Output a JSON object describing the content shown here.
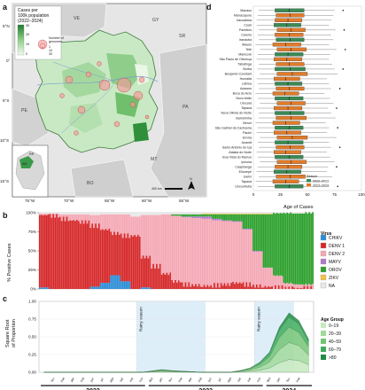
{
  "panel_labels": {
    "a": "a",
    "b": "b",
    "c": "c",
    "d": "d"
  },
  "map": {
    "legend_title": "Cases per\n100k population\n(2022–2024)",
    "legend_ticks": [
      "0",
      "1K",
      "2K",
      "3K"
    ],
    "bubble_title": "Number of\ngenomes",
    "bubble_values": [
      "1",
      "10",
      "30"
    ],
    "country_labels": [
      "VE",
      "CO",
      "GY",
      "SR",
      "PE",
      "BO",
      "PA",
      "MT",
      "AM",
      "RR"
    ],
    "lat_labels": [
      "5°N",
      "0°",
      "5°S",
      "10°S",
      "15°S"
    ],
    "lon_labels": [
      "75°W",
      "70°W",
      "65°W",
      "60°W",
      "55°W"
    ],
    "scale_label": "400 km",
    "north": "N",
    "inset_label": "AM"
  },
  "colors": {
    "CHIKV": "#2b8cd6",
    "DENV1": "#d62728",
    "DENV2": "#f4a7b4",
    "MAYV": "#b07ac8",
    "OROV": "#2ca02c",
    "ZIKV": "#f3c244",
    "NA": "#e8e8e8",
    "age": [
      "#c7e9c0",
      "#a1d99b",
      "#74c476",
      "#41ab5d",
      "#238b45",
      "#005a32"
    ],
    "box2022": "#3a8a54",
    "box2023": "#e07b2a"
  },
  "chart_data": [
    {
      "panel": "b",
      "type": "bar",
      "ylabel": "% Positive Cases",
      "yticks": [
        "0%",
        "25%",
        "50%",
        "75%",
        "100%"
      ],
      "ylim": [
        0,
        100
      ],
      "legend_title": "Virus",
      "legend": [
        "CHIKV",
        "DENV 1",
        "DENV 2",
        "MAYV",
        "OROV",
        "ZIKV",
        "NA"
      ],
      "categories": [
        "Jan 2022",
        "Feb 2022",
        "Mar 2022",
        "Apr 2022",
        "May 2022",
        "Jun 2022",
        "Jul 2022",
        "Aug 2022",
        "Sep 2022",
        "Oct 2022",
        "Nov 2022",
        "Dec 2022",
        "Jan 2023",
        "Feb 2023",
        "Mar 2023",
        "Apr 2023",
        "May 2023",
        "Jun 2023",
        "Jul 2023",
        "Aug 2023",
        "Sep 2023",
        "Oct 2023",
        "Nov 2023",
        "Dec 2023",
        "Jan 2024",
        "Feb 2024",
        "Mar 2024"
      ],
      "series": [
        {
          "name": "CHIKV",
          "values": [
            2,
            0,
            0,
            0,
            0,
            3,
            8,
            18,
            10,
            0,
            2,
            0,
            0,
            0,
            0,
            0,
            0,
            0,
            0,
            0,
            0,
            0,
            0,
            0,
            0,
            0,
            0
          ]
        },
        {
          "name": "DENV 1",
          "values": [
            95,
            96,
            92,
            90,
            88,
            80,
            70,
            55,
            60,
            70,
            40,
            30,
            20,
            10,
            6,
            5,
            4,
            5,
            6,
            8,
            6,
            4,
            3,
            2,
            1,
            1,
            1
          ]
        },
        {
          "name": "DENV 2",
          "values": [
            2,
            3,
            6,
            8,
            10,
            14,
            20,
            25,
            28,
            25,
            55,
            67,
            78,
            86,
            88,
            88,
            88,
            85,
            83,
            80,
            72,
            45,
            25,
            15,
            6,
            5,
            4
          ]
        },
        {
          "name": "MAYV",
          "values": [
            0,
            0,
            0,
            0,
            0,
            0,
            0,
            0,
            0,
            0,
            0,
            0,
            0,
            0,
            1,
            2,
            3,
            2,
            1,
            1,
            1,
            1,
            0,
            0,
            0,
            0,
            0
          ]
        },
        {
          "name": "OROV",
          "values": [
            0,
            0,
            0,
            0,
            0,
            0,
            0,
            0,
            0,
            0,
            0,
            0,
            0,
            2,
            3,
            3,
            3,
            6,
            8,
            9,
            19,
            48,
            70,
            82,
            92,
            93,
            94
          ]
        },
        {
          "name": "ZIKV",
          "values": [
            0,
            0,
            0,
            0,
            0,
            0,
            0,
            0,
            0,
            0,
            0,
            0,
            0,
            0,
            0,
            0,
            1,
            1,
            1,
            1,
            1,
            1,
            1,
            0,
            0,
            0,
            0
          ]
        },
        {
          "name": "NA",
          "values": [
            1,
            1,
            2,
            2,
            2,
            3,
            2,
            2,
            2,
            5,
            3,
            3,
            2,
            2,
            2,
            2,
            1,
            1,
            1,
            1,
            1,
            1,
            1,
            1,
            1,
            1,
            1
          ]
        }
      ]
    },
    {
      "panel": "c",
      "type": "area",
      "ylabel": "Square Root\nof Proportion",
      "yticks": [
        "0.00",
        "0.25",
        "0.50",
        "0.75",
        "1.00"
      ],
      "ylim": [
        0,
        1
      ],
      "annotations": [
        "Rainy season",
        "Rainy season"
      ],
      "rainy_seasons": [
        [
          10,
          17
        ],
        [
          22,
          26
        ]
      ],
      "x_month_labels": [
        "fev",
        "mar",
        "abr",
        "mai",
        "jun",
        "jul",
        "ago",
        "set",
        "out",
        "nov",
        "dez",
        "jan",
        "fev",
        "mar",
        "abr",
        "mai",
        "jun",
        "jul",
        "ago",
        "set",
        "out",
        "nov",
        "dez",
        "jan",
        "fev",
        "mar"
      ],
      "years": [
        "2022",
        "2023",
        "2024"
      ],
      "legend_title": "Age Group",
      "legend": [
        "0–19",
        "20–39",
        "40–59",
        "60–79",
        ">80"
      ],
      "series": [
        {
          "name": "0–19",
          "values": [
            0,
            0,
            0,
            0,
            0,
            0,
            0,
            0,
            0,
            0,
            0,
            0.02,
            0.03,
            0.02,
            0.01,
            0.01,
            0,
            0,
            0,
            0,
            0.02,
            0.05,
            0.1,
            0.2,
            0.45,
            0.6,
            0.55,
            0.35
          ]
        },
        {
          "name": "20–39",
          "values": [
            0,
            0,
            0,
            0,
            0,
            0,
            0,
            0,
            0,
            0,
            0,
            0.02,
            0.04,
            0.03,
            0.02,
            0.01,
            0,
            0,
            0,
            0,
            0.03,
            0.06,
            0.14,
            0.28,
            0.62,
            0.8,
            0.7,
            0.45
          ]
        },
        {
          "name": "40–59",
          "values": [
            0,
            0,
            0,
            0,
            0,
            0,
            0,
            0,
            0,
            0,
            0,
            0.01,
            0.03,
            0.02,
            0.01,
            0.01,
            0,
            0,
            0,
            0,
            0.02,
            0.05,
            0.12,
            0.25,
            0.55,
            0.72,
            0.62,
            0.4
          ]
        },
        {
          "name": "60–79",
          "values": [
            0,
            0,
            0,
            0,
            0,
            0,
            0,
            0,
            0,
            0,
            0,
            0.01,
            0.02,
            0.01,
            0.01,
            0,
            0,
            0,
            0,
            0,
            0.01,
            0.03,
            0.08,
            0.16,
            0.36,
            0.48,
            0.4,
            0.25
          ]
        },
        {
          "name": ">80",
          "values": [
            0,
            0,
            0,
            0,
            0,
            0,
            0,
            0,
            0,
            0,
            0,
            0,
            0.01,
            0,
            0,
            0,
            0,
            0,
            0,
            0,
            0,
            0.01,
            0.03,
            0.06,
            0.14,
            0.2,
            0.16,
            0.1
          ]
        }
      ]
    },
    {
      "panel": "d",
      "type": "boxplot",
      "xlabel": "Age of Cases",
      "xlim": [
        0,
        100
      ],
      "xticks": [
        "0",
        "25",
        "50",
        "75",
        "100"
      ],
      "legend_title": "Season",
      "legend": [
        "2022–2023",
        "2023–2024"
      ],
      "categories": [
        "Manaus",
        "Manacapuru",
        "Itacoatiara",
        "Coari",
        "Parintins",
        "Careiro",
        "Iranduba",
        "Maués",
        "Tefé",
        "Manicoré",
        "São Paulo de Olivença",
        "Tabatinga",
        "Borba",
        "Benjamin Constant",
        "Humaitá",
        "Lábrea",
        "Autazes",
        "Boca do Acre",
        "Novo Airão",
        "Urucará",
        "Tapauá",
        "Nova Olinda do Norte",
        "Barreirinha",
        "Beruri",
        "São Gabriel da Cachoeira",
        "Pauini",
        "Envira",
        "Anamã",
        "Santo Antônio do Içá",
        "Atalaia do Norte",
        "Boa Vista do Ramos",
        "Ipixuna",
        "Caapiranga",
        "Eirunepé",
        "Uarini",
        "Tapauá",
        "Urucurituba"
      ],
      "boxes": [
        {
          "q1": 20,
          "median": 33,
          "q3": 47,
          "min": 5,
          "max": 75
        },
        {
          "q1": 21,
          "median": 34,
          "q3": 47,
          "min": 4,
          "max": 74
        },
        {
          "q1": 20,
          "median": 32,
          "q3": 45,
          "min": 3,
          "max": 72
        },
        {
          "q1": 19,
          "median": 31,
          "q3": 44,
          "min": 3,
          "max": 70
        },
        {
          "q1": 22,
          "median": 35,
          "q3": 48,
          "min": 5,
          "max": 76
        },
        {
          "q1": 20,
          "median": 33,
          "q3": 46,
          "min": 4,
          "max": 72
        },
        {
          "q1": 21,
          "median": 34,
          "q3": 47,
          "min": 5,
          "max": 74
        },
        {
          "q1": 18,
          "median": 30,
          "q3": 44,
          "min": 2,
          "max": 70
        },
        {
          "q1": 22,
          "median": 35,
          "q3": 49,
          "min": 6,
          "max": 77
        },
        {
          "q1": 20,
          "median": 32,
          "q3": 46,
          "min": 4,
          "max": 71
        },
        {
          "q1": 19,
          "median": 31,
          "q3": 45,
          "min": 3,
          "max": 70
        },
        {
          "q1": 21,
          "median": 33,
          "q3": 47,
          "min": 5,
          "max": 73
        },
        {
          "q1": 20,
          "median": 34,
          "q3": 48,
          "min": 4,
          "max": 75
        },
        {
          "q1": 22,
          "median": 36,
          "q3": 50,
          "min": 6,
          "max": 78
        },
        {
          "q1": 19,
          "median": 30,
          "q3": 43,
          "min": 3,
          "max": 68
        },
        {
          "q1": 20,
          "median": 32,
          "q3": 45,
          "min": 4,
          "max": 70
        },
        {
          "q1": 21,
          "median": 33,
          "q3": 47,
          "min": 5,
          "max": 72
        },
        {
          "q1": 18,
          "median": 29,
          "q3": 42,
          "min": 2,
          "max": 66
        },
        {
          "q1": 20,
          "median": 33,
          "q3": 46,
          "min": 4,
          "max": 71
        },
        {
          "q1": 22,
          "median": 35,
          "q3": 48,
          "min": 6,
          "max": 74
        },
        {
          "q1": 19,
          "median": 32,
          "q3": 45,
          "min": 3,
          "max": 69
        },
        {
          "q1": 20,
          "median": 34,
          "q3": 47,
          "min": 5,
          "max": 72
        },
        {
          "q1": 21,
          "median": 35,
          "q3": 49,
          "min": 5,
          "max": 76
        },
        {
          "q1": 18,
          "median": 30,
          "q3": 43,
          "min": 2,
          "max": 67
        },
        {
          "q1": 20,
          "median": 33,
          "q3": 46,
          "min": 4,
          "max": 70
        },
        {
          "q1": 19,
          "median": 31,
          "q3": 44,
          "min": 3,
          "max": 68
        },
        {
          "q1": 22,
          "median": 36,
          "q3": 50,
          "min": 6,
          "max": 77
        },
        {
          "q1": 20,
          "median": 32,
          "q3": 46,
          "min": 4,
          "max": 70
        },
        {
          "q1": 21,
          "median": 34,
          "q3": 47,
          "min": 5,
          "max": 72
        },
        {
          "q1": 19,
          "median": 30,
          "q3": 44,
          "min": 3,
          "max": 68
        },
        {
          "q1": 20,
          "median": 33,
          "q3": 46,
          "min": 4,
          "max": 71
        },
        {
          "q1": 22,
          "median": 35,
          "q3": 49,
          "min": 6,
          "max": 75
        },
        {
          "q1": 20,
          "median": 32,
          "q3": 45,
          "min": 4,
          "max": 69
        },
        {
          "q1": 19,
          "median": 31,
          "q3": 44,
          "min": 3,
          "max": 68
        },
        {
          "q1": 21,
          "median": 34,
          "q3": 48,
          "min": 5,
          "max": 73
        },
        {
          "q1": 18,
          "median": 30,
          "q3": 42,
          "min": 2,
          "max": 65
        },
        {
          "q1": 20,
          "median": 33,
          "q3": 46,
          "min": 4,
          "max": 70
        }
      ]
    }
  ]
}
